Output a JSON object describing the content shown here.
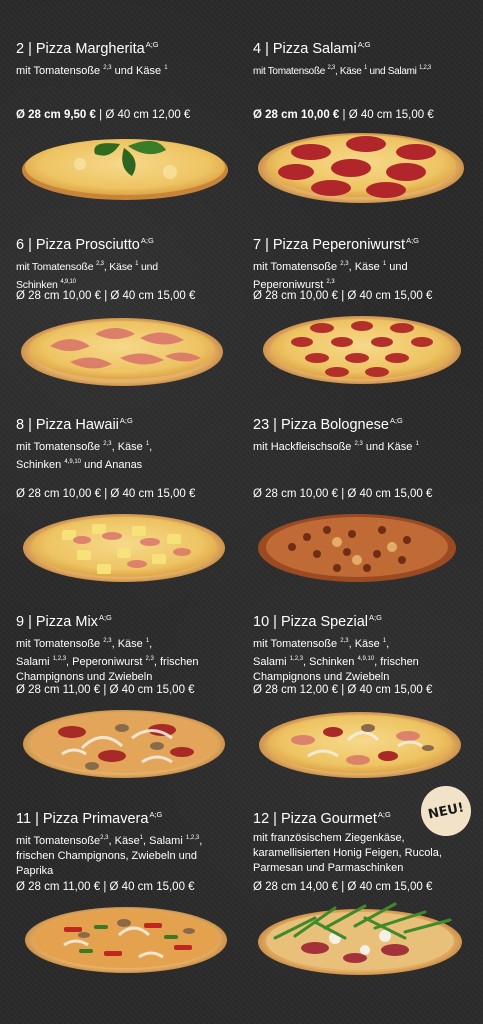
{
  "badge": "NEU!",
  "items": [
    {
      "title": "2 | Pizza Margherita",
      "allergens": "A;G",
      "desc": "mit Tomatensoße",
      "desc_sup": "2,3",
      "desc_rest": " und Käse",
      "desc_sup2": "1",
      "price_small": "Ø 28 cm 9,50 €",
      "price_sep": " | ",
      "price_large": "Ø 40 cm 12,00 €"
    },
    {
      "title": "4 | Pizza Salami",
      "allergens": "A;G",
      "desc": "mit Tomatensoße",
      "desc_sup": "2,3",
      "desc_rest": ", Käse",
      "desc_sup2": "1",
      "desc_rest2": " und Salami",
      "desc_sup3": "1,2,3",
      "price_small": "Ø 28 cm 10,00 €",
      "price_sep": " | ",
      "price_large": "Ø 40 cm 15,00 €"
    },
    {
      "title": "6 | Pizza Prosciutto",
      "allergens": "A;G",
      "line1": "mit Tomatensoße",
      "sup1": "2,3",
      "line1b": ", Käse",
      "sup1b": "1",
      "line1c": " und",
      "line2": "Schinken",
      "sup2": "4,9,10",
      "price": "Ø 28 cm 10,00 € | Ø 40 cm 15,00 €"
    },
    {
      "title": "7 | Pizza Peperoniwurst",
      "allergens": "A;G",
      "line1": "mit Tomatensoße",
      "sup1": "2,3",
      "line1b": ", Käse",
      "sup1b": "1",
      "line1c": " und",
      "line2": "Peperoniwurst",
      "sup2": "2,3",
      "price": "Ø 28 cm 10,00 € | Ø 40 cm 15,00 €"
    },
    {
      "title": "8 | Pizza Hawaii",
      "allergens": "A;G",
      "line1": "mit Tomatensoße",
      "sup1": "2,3",
      "line1b": ", Käse",
      "sup1b": "1",
      "line1c": ",",
      "line2": "Schinken",
      "sup2": "4,9,10",
      "line2b": " und Ananas",
      "price": "Ø 28 cm 10,00 € | Ø 40 cm 15,00 €"
    },
    {
      "title": "23 | Pizza Bolognese",
      "allergens": "A;G",
      "line1": "mit Hackfleischsoße",
      "sup1": "2,3",
      "line1b": " und  Käse",
      "sup1b": "1",
      "price": "Ø 28 cm 10,00 € | Ø 40 cm 15,00 €"
    },
    {
      "title": "9 | Pizza Mix",
      "allergens": "A;G",
      "line1": "mit Tomatensoße",
      "sup1": "2,3",
      "line1b": ", Käse",
      "sup1b": "1",
      "line1c": ",",
      "line2": "Salami",
      "sup2": "1,2,3",
      "line2b": ", Peperoniwurst",
      "sup2b": "2,3",
      "line2c": ", frischen",
      "line3": "Champignons und Zwiebeln",
      "price": "Ø 28 cm 11,00 € | Ø 40 cm 15,00 €"
    },
    {
      "title": "10 | Pizza Spezial",
      "allergens": "A;G",
      "line1": "mit Tomatensoße",
      "sup1": "2,3",
      "line1b": ", Käse",
      "sup1b": "1",
      "line1c": ",",
      "line2": "Salami",
      "sup2": "1,2,3",
      "line2b": ", Schinken",
      "sup2b": "4,9,10",
      "line2c": ", frischen",
      "line3": "Champignons und Zwiebeln",
      "price": "Ø 28 cm 12,00 € | Ø 40 cm 15,00 €"
    },
    {
      "title": "11 | Pizza Primavera",
      "allergens": "A;G",
      "line1": "mit Tomatensoße",
      "sup1": "2,3",
      "line1b": ", Käse",
      "sup1b": "1",
      "line1c": ", Salami",
      "sup1c": "1,2,3",
      ",": "",
      "line1d": ",",
      "line2": "frischen Champignons, Zwiebeln und",
      "line3": "Paprika",
      "price": "Ø 28 cm 11,00 € | Ø 40 cm 15,00 €"
    },
    {
      "title": "12 | Pizza Gourmet",
      "allergens": "A;G",
      "line1": "mit französischem Ziegenkäse,",
      "line2": "karamellisierten Honig Feigen, Rucola,",
      "line3": "Parmesan und Parmaschinken",
      "price": "Ø 28 cm 14,00 € | Ø 40 cm 15,00 €"
    }
  ]
}
